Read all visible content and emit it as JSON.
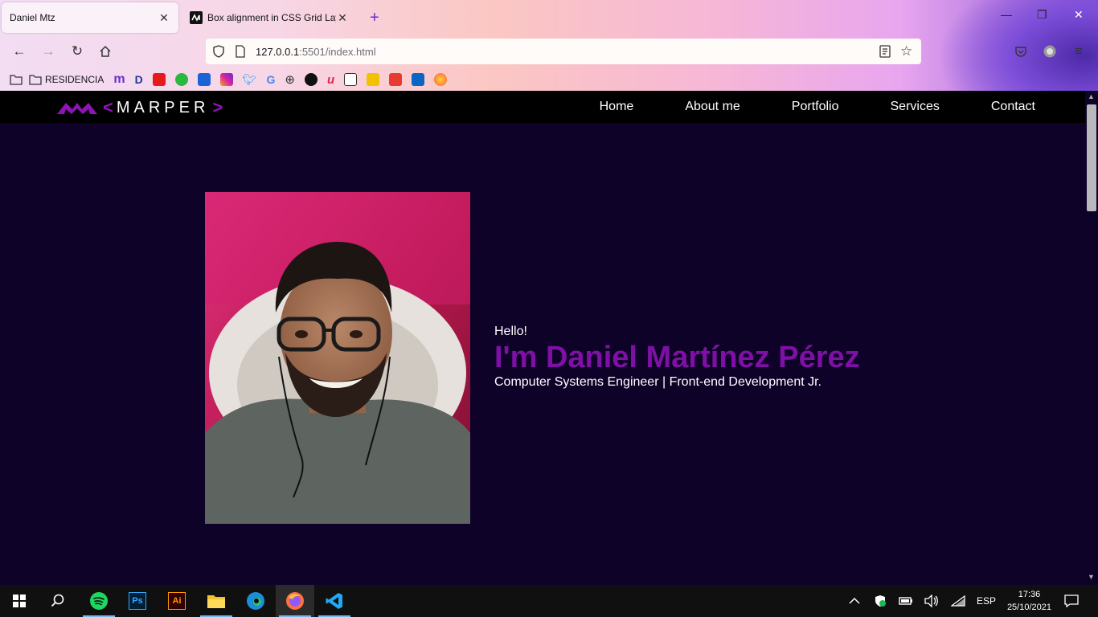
{
  "browser": {
    "tabs": [
      {
        "title": "Daniel Mtz",
        "active": true
      },
      {
        "title": "Box alignment in CSS Grid Layo",
        "active": false
      }
    ],
    "url_host": "127.0.0.1",
    "url_path": ":5501/index.html",
    "bookmarks": {
      "folder_label": "RESIDENCIA"
    }
  },
  "site": {
    "logo_text": "MARPER",
    "logo_left_bracket": "<",
    "logo_right_bracket": ">",
    "nav": [
      "Home",
      "About me",
      "Portfolio",
      "Services",
      "Contact"
    ],
    "hero": {
      "greeting": "Hello!",
      "name": "I'm Daniel Martínez Pérez",
      "role": "Computer Systems Engineer | Front-end Development Jr."
    }
  },
  "taskbar": {
    "language": "ESP",
    "time": "17:36",
    "date": "25/10/2021"
  },
  "colors": {
    "page_bg": "#0f0228",
    "accent_purple": "#7e10a5",
    "header_bg": "#000000"
  }
}
